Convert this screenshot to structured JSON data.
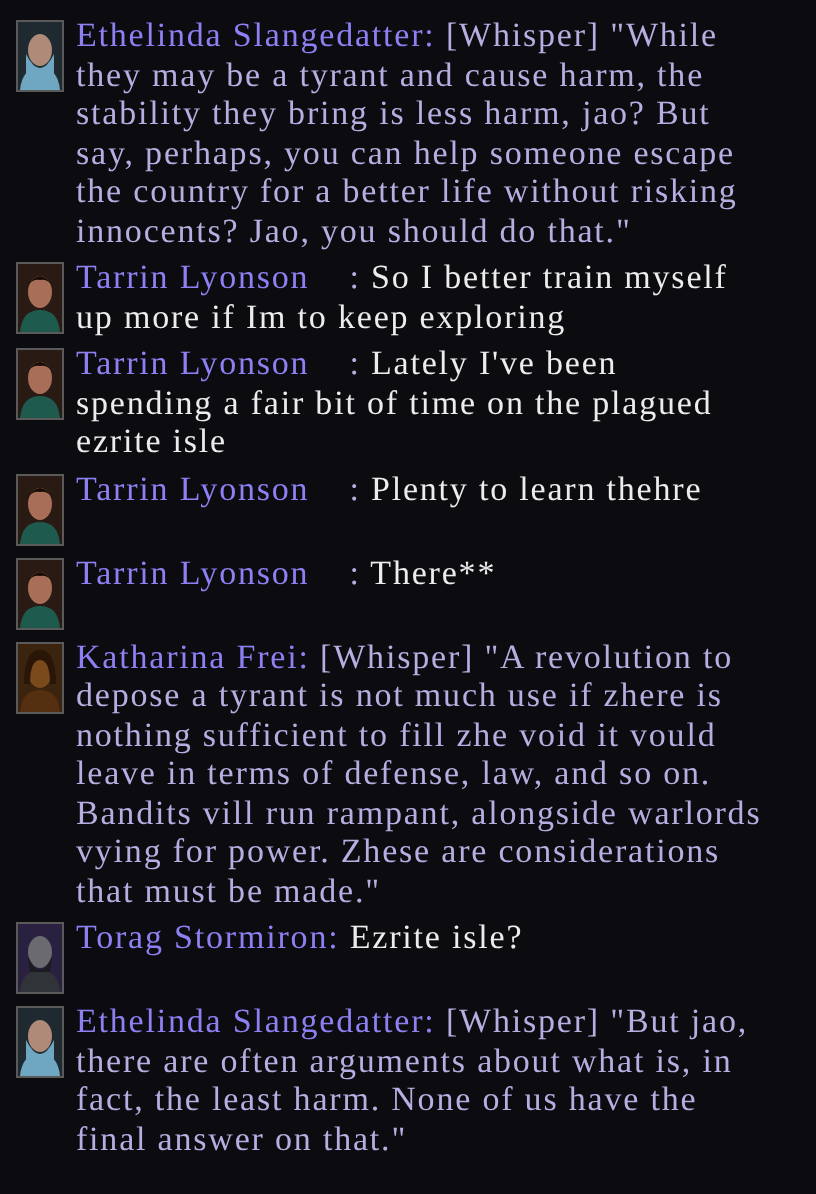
{
  "messages": [
    {
      "name": "Ethelinda Slangedatter:",
      "channel": "[Whisper]",
      "text": "\"While they may be a tyrant and cause harm, the stability they bring is less harm, jao? But say, perhaps, you can help someone escape the country for a better life without risking innocents? Jao, you should do that.\"",
      "kind": "whisper",
      "avatar": {
        "kind": "veiled"
      }
    },
    {
      "name": "Tarrin Lyonson",
      "separator": ":",
      "text": "So I better train myself up more if Im to keep exploring",
      "kind": "say",
      "avatar": {
        "kind": "dark-hair"
      }
    },
    {
      "name": "Tarrin Lyonson",
      "separator": ":",
      "text": "Lately I've been spending a fair bit of time on the plagued ezrite isle",
      "kind": "say",
      "avatar": {
        "kind": "dark-hair"
      }
    },
    {
      "name": "Tarrin Lyonson",
      "separator": ":",
      "text": "Plenty to learn thehre",
      "kind": "say",
      "avatar": {
        "kind": "dark-hair"
      }
    },
    {
      "name": "Tarrin Lyonson",
      "separator": ":",
      "text": "There**",
      "kind": "say",
      "avatar": {
        "kind": "dark-hair"
      }
    },
    {
      "name": "Katharina Frei:",
      "channel": "[Whisper]",
      "text": "\"A revolution to depose a tyrant is not much use if zhere is nothing sufficient to fill zhe void it vould leave in terms of defense, law, and so on. Bandits vill run rampant, alongside warlords vying for power. Zhese are considerations that must be made.\"",
      "kind": "whisper",
      "avatar": {
        "kind": "hooded"
      }
    },
    {
      "name": "Torag Stormiron:",
      "text": "Ezrite isle?",
      "kind": "say",
      "avatar": {
        "kind": "bearded"
      }
    },
    {
      "name": "Ethelinda Slangedatter:",
      "channel": "[Whisper]",
      "text": "\"But jao, there are often arguments about what is, in fact, the least harm. None of us have the final answer on that.\"",
      "kind": "whisper",
      "avatar": {
        "kind": "veiled"
      }
    }
  ]
}
